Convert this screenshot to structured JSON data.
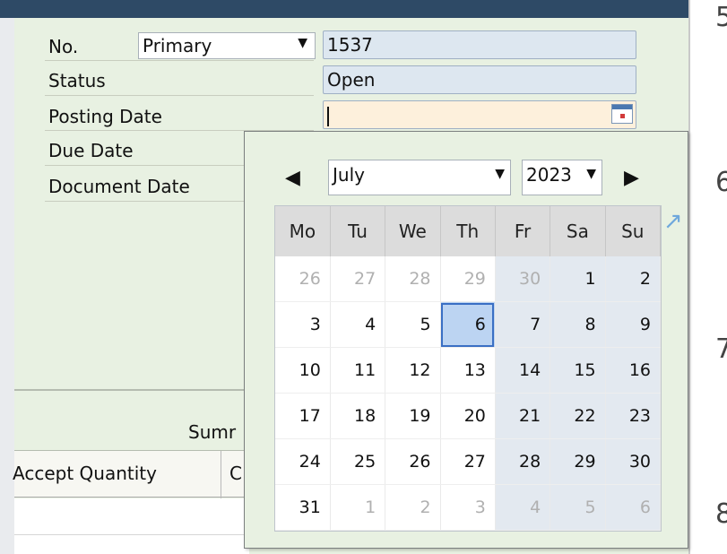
{
  "form": {
    "no_label": "No.",
    "series_value": "Primary",
    "doc_number": "1537",
    "status_label": "Status",
    "status_value": "Open",
    "posting_date_label": "Posting Date",
    "posting_date_value": "",
    "due_date_label": "Due Date",
    "document_date_label": "Document Date",
    "summary_label": "Sumr"
  },
  "grid": {
    "col_accept_quantity": "Accept Quantity",
    "col_partial": "C"
  },
  "side_numbers": [
    "5",
    "6",
    "7",
    "8"
  ],
  "calendar": {
    "month": "July",
    "year": "2023",
    "weekdays": [
      "Mo",
      "Tu",
      "We",
      "Th",
      "Fr",
      "Sa",
      "Su"
    ],
    "weeks": [
      [
        {
          "d": "26",
          "o": true
        },
        {
          "d": "27",
          "o": true
        },
        {
          "d": "28",
          "o": true
        },
        {
          "d": "29",
          "o": true
        },
        {
          "d": "30",
          "o": true
        },
        {
          "d": "1"
        },
        {
          "d": "2"
        }
      ],
      [
        {
          "d": "3"
        },
        {
          "d": "4"
        },
        {
          "d": "5"
        },
        {
          "d": "6",
          "today": true
        },
        {
          "d": "7"
        },
        {
          "d": "8"
        },
        {
          "d": "9"
        }
      ],
      [
        {
          "d": "10"
        },
        {
          "d": "11"
        },
        {
          "d": "12"
        },
        {
          "d": "13"
        },
        {
          "d": "14"
        },
        {
          "d": "15"
        },
        {
          "d": "16"
        }
      ],
      [
        {
          "d": "17"
        },
        {
          "d": "18"
        },
        {
          "d": "19"
        },
        {
          "d": "20"
        },
        {
          "d": "21"
        },
        {
          "d": "22"
        },
        {
          "d": "23"
        }
      ],
      [
        {
          "d": "24"
        },
        {
          "d": "25"
        },
        {
          "d": "26"
        },
        {
          "d": "27"
        },
        {
          "d": "28"
        },
        {
          "d": "29"
        },
        {
          "d": "30"
        }
      ],
      [
        {
          "d": "31"
        },
        {
          "d": "1",
          "o": true
        },
        {
          "d": "2",
          "o": true
        },
        {
          "d": "3",
          "o": true
        },
        {
          "d": "4",
          "o": true
        },
        {
          "d": "5",
          "o": true
        },
        {
          "d": "6",
          "o": true
        }
      ]
    ]
  }
}
